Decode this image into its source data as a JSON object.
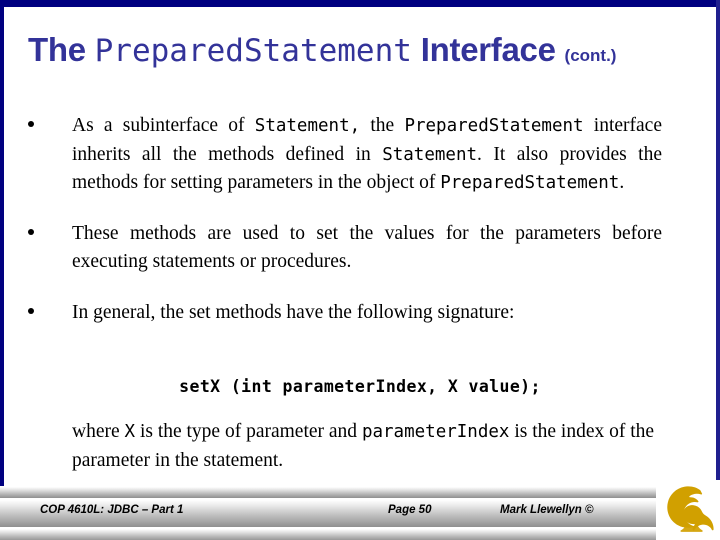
{
  "slide": {
    "accent_color": "#333399",
    "border_color": "#000080",
    "logo_color": "#D1A000"
  },
  "title": {
    "lead": "The ",
    "code": "PreparedStatement",
    "tail": " Interface ",
    "suffix": "(cont.)"
  },
  "bullets": [
    {
      "segments": [
        {
          "type": "text",
          "value": "As a subinterface of "
        },
        {
          "type": "code",
          "value": "Statement,"
        },
        {
          "type": "text",
          "value": " the "
        },
        {
          "type": "code",
          "value": "PreparedStatement"
        },
        {
          "type": "text",
          "value": " interface inherits all the methods defined in "
        },
        {
          "type": "code",
          "value": "Statement"
        },
        {
          "type": "text",
          "value": ".  It also provides the methods for setting parameters in the object of "
        },
        {
          "type": "code",
          "value": "PreparedStatement"
        },
        {
          "type": "text",
          "value": "."
        }
      ]
    },
    {
      "segments": [
        {
          "type": "text",
          "value": "These methods are used to set the values for the parameters before executing statements or procedures."
        }
      ]
    },
    {
      "segments": [
        {
          "type": "text",
          "value": "In general, the set methods have the following signature:"
        }
      ]
    }
  ],
  "signature": "setX (int parameterIndex, X value);",
  "closing": {
    "segments": [
      {
        "type": "text",
        "value": "where "
      },
      {
        "type": "code",
        "value": "X"
      },
      {
        "type": "text",
        "value": " is the type of parameter and "
      },
      {
        "type": "code",
        "value": "parameterIndex"
      },
      {
        "type": "text",
        "value": " is the index of the parameter in the statement."
      }
    ]
  },
  "footer": {
    "course": "COP 4610L: JDBC – Part 1",
    "page": "Page 50",
    "author": "Mark Llewellyn ©"
  }
}
